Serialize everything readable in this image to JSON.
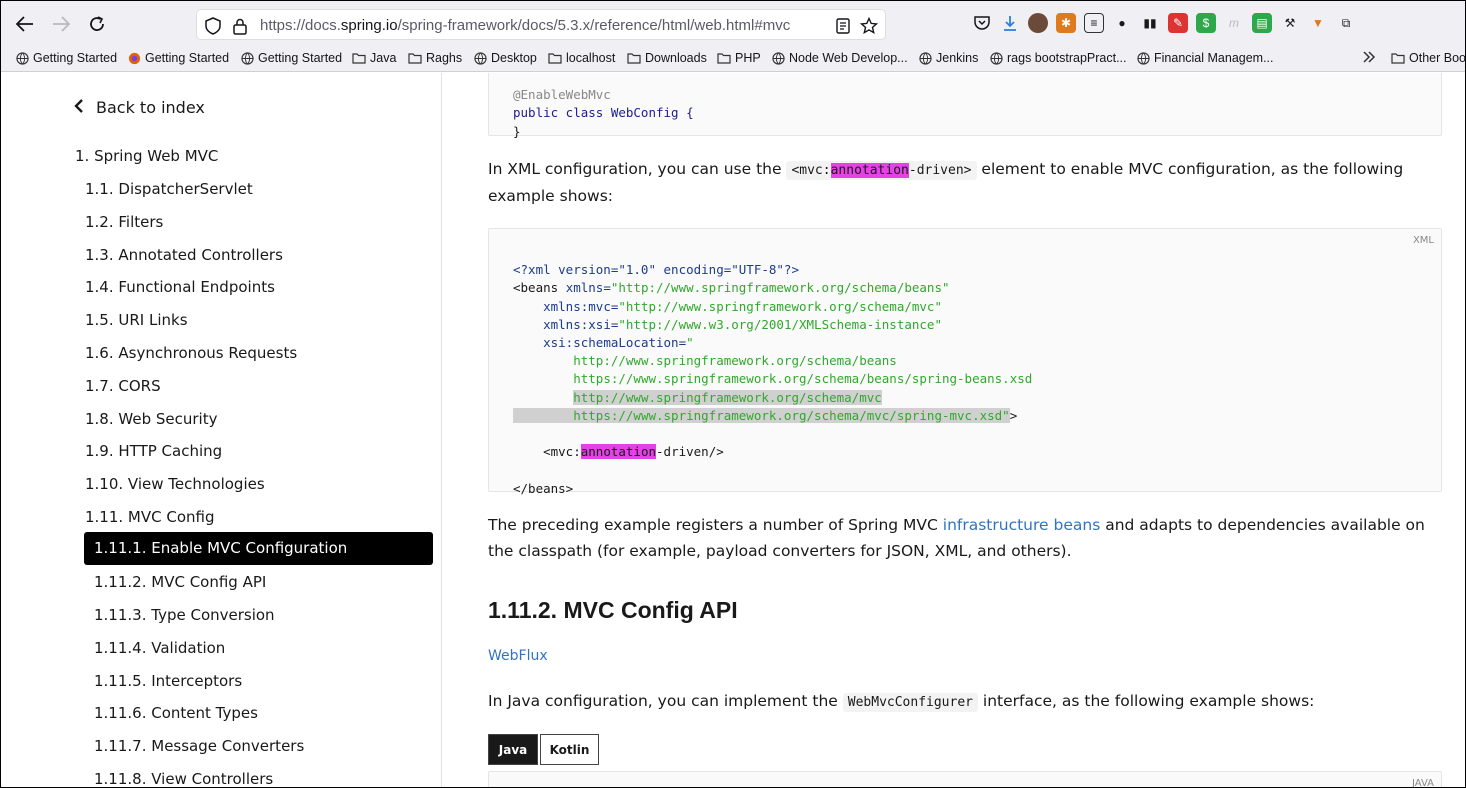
{
  "browser": {
    "url_prefix": "https://docs.",
    "url_domain": "spring.io",
    "url_path": "/spring-framework/docs/5.3.x/reference/html/web.html#mvc",
    "bookmarks": [
      {
        "label": "Getting Started",
        "icon": "globe-icon"
      },
      {
        "label": "Getting Started",
        "icon": "firefox-icon"
      },
      {
        "label": "Getting Started",
        "icon": "globe-icon"
      },
      {
        "label": "Java",
        "icon": "folder-icon"
      },
      {
        "label": "Raghs",
        "icon": "folder-icon"
      },
      {
        "label": "Desktop",
        "icon": "globe-icon"
      },
      {
        "label": "localhost",
        "icon": "folder-icon"
      },
      {
        "label": "Downloads",
        "icon": "folder-icon"
      },
      {
        "label": "PHP",
        "icon": "folder-icon"
      },
      {
        "label": "Node Web Develop...",
        "icon": "globe-icon"
      },
      {
        "label": "Jenkins",
        "icon": "globe-icon"
      },
      {
        "label": "rags bootstrapPract...",
        "icon": "globe-icon"
      },
      {
        "label": "Financial Managem...",
        "icon": "globe-icon"
      },
      {
        "label": "Other Boo",
        "icon": "folder-icon"
      }
    ]
  },
  "sidebar": {
    "back_label": "Back to index",
    "items": [
      "1. Spring Web MVC",
      "1.1. DispatcherServlet",
      "1.2. Filters",
      "1.3. Annotated Controllers",
      "1.4. Functional Endpoints",
      "1.5. URI Links",
      "1.6. Asynchronous Requests",
      "1.7. CORS",
      "1.8. Web Security",
      "1.9. HTTP Caching",
      "1.10. View Technologies",
      "1.11. MVC Config",
      "1.11.1. Enable MVC Configuration",
      "1.11.2. MVC Config API",
      "1.11.3. Type Conversion",
      "1.11.4. Validation",
      "1.11.5. Interceptors",
      "1.11.6. Content Types",
      "1.11.7. Message Converters",
      "1.11.8. View Controllers"
    ]
  },
  "content": {
    "code1": {
      "line1": "@EnableWebMvc",
      "line2": "public class WebConfig {",
      "line3": "}"
    },
    "para1_a": "In XML configuration, you can use the ",
    "para1_code_a": "<mvc:",
    "para1_code_hl": "annotation",
    "para1_code_b": "-driven>",
    "para1_b": " element to enable MVC configuration, as the following example shows:",
    "code2_lang": "XML",
    "code2": {
      "l1": "<?xml version=\"1.0\" encoding=\"UTF-8\"?>",
      "l2_tag": "<beans ",
      "l2_attr": "xmlns=",
      "l2_val": "\"http://www.springframework.org/schema/beans\"",
      "l3_attr": "xmlns:mvc=",
      "l3_val": "\"http://www.springframework.org/schema/mvc\"",
      "l4_attr": "xmlns:xsi=",
      "l4_val": "\"http://www.w3.org/2001/XMLSchema-instance\"",
      "l5_attr": "xsi:schemaLocation=",
      "l5_val": "\"",
      "l6": "http://www.springframework.org/schema/beans",
      "l7": "https://www.springframework.org/schema/beans/spring-beans.xsd",
      "l8": "http://www.springframework.org/schema/mvc",
      "l9": "https://www.springframework.org/schema/mvc/spring-mvc.xsd\"",
      "l9_end": ">",
      "l10_a": "<mvc:",
      "l10_hl": "annotation",
      "l10_b": "-driven/>",
      "l11": "</beans>"
    },
    "para2_a": "The preceding example registers a number of Spring MVC ",
    "para2_link": "infrastructure beans",
    "para2_b": " and adapts to dependencies available on the classpath (for example, payload converters for JSON, XML, and others).",
    "heading": "1.11.2. MVC Config API",
    "webflux_link": "WebFlux",
    "para3_a": "In Java configuration, you can implement the ",
    "para3_code": "WebMvcConfigurer",
    "para3_b": " interface, as the following example shows:",
    "tab_java": "Java",
    "tab_kotlin": "Kotlin",
    "code3_lang": "JAVA"
  }
}
